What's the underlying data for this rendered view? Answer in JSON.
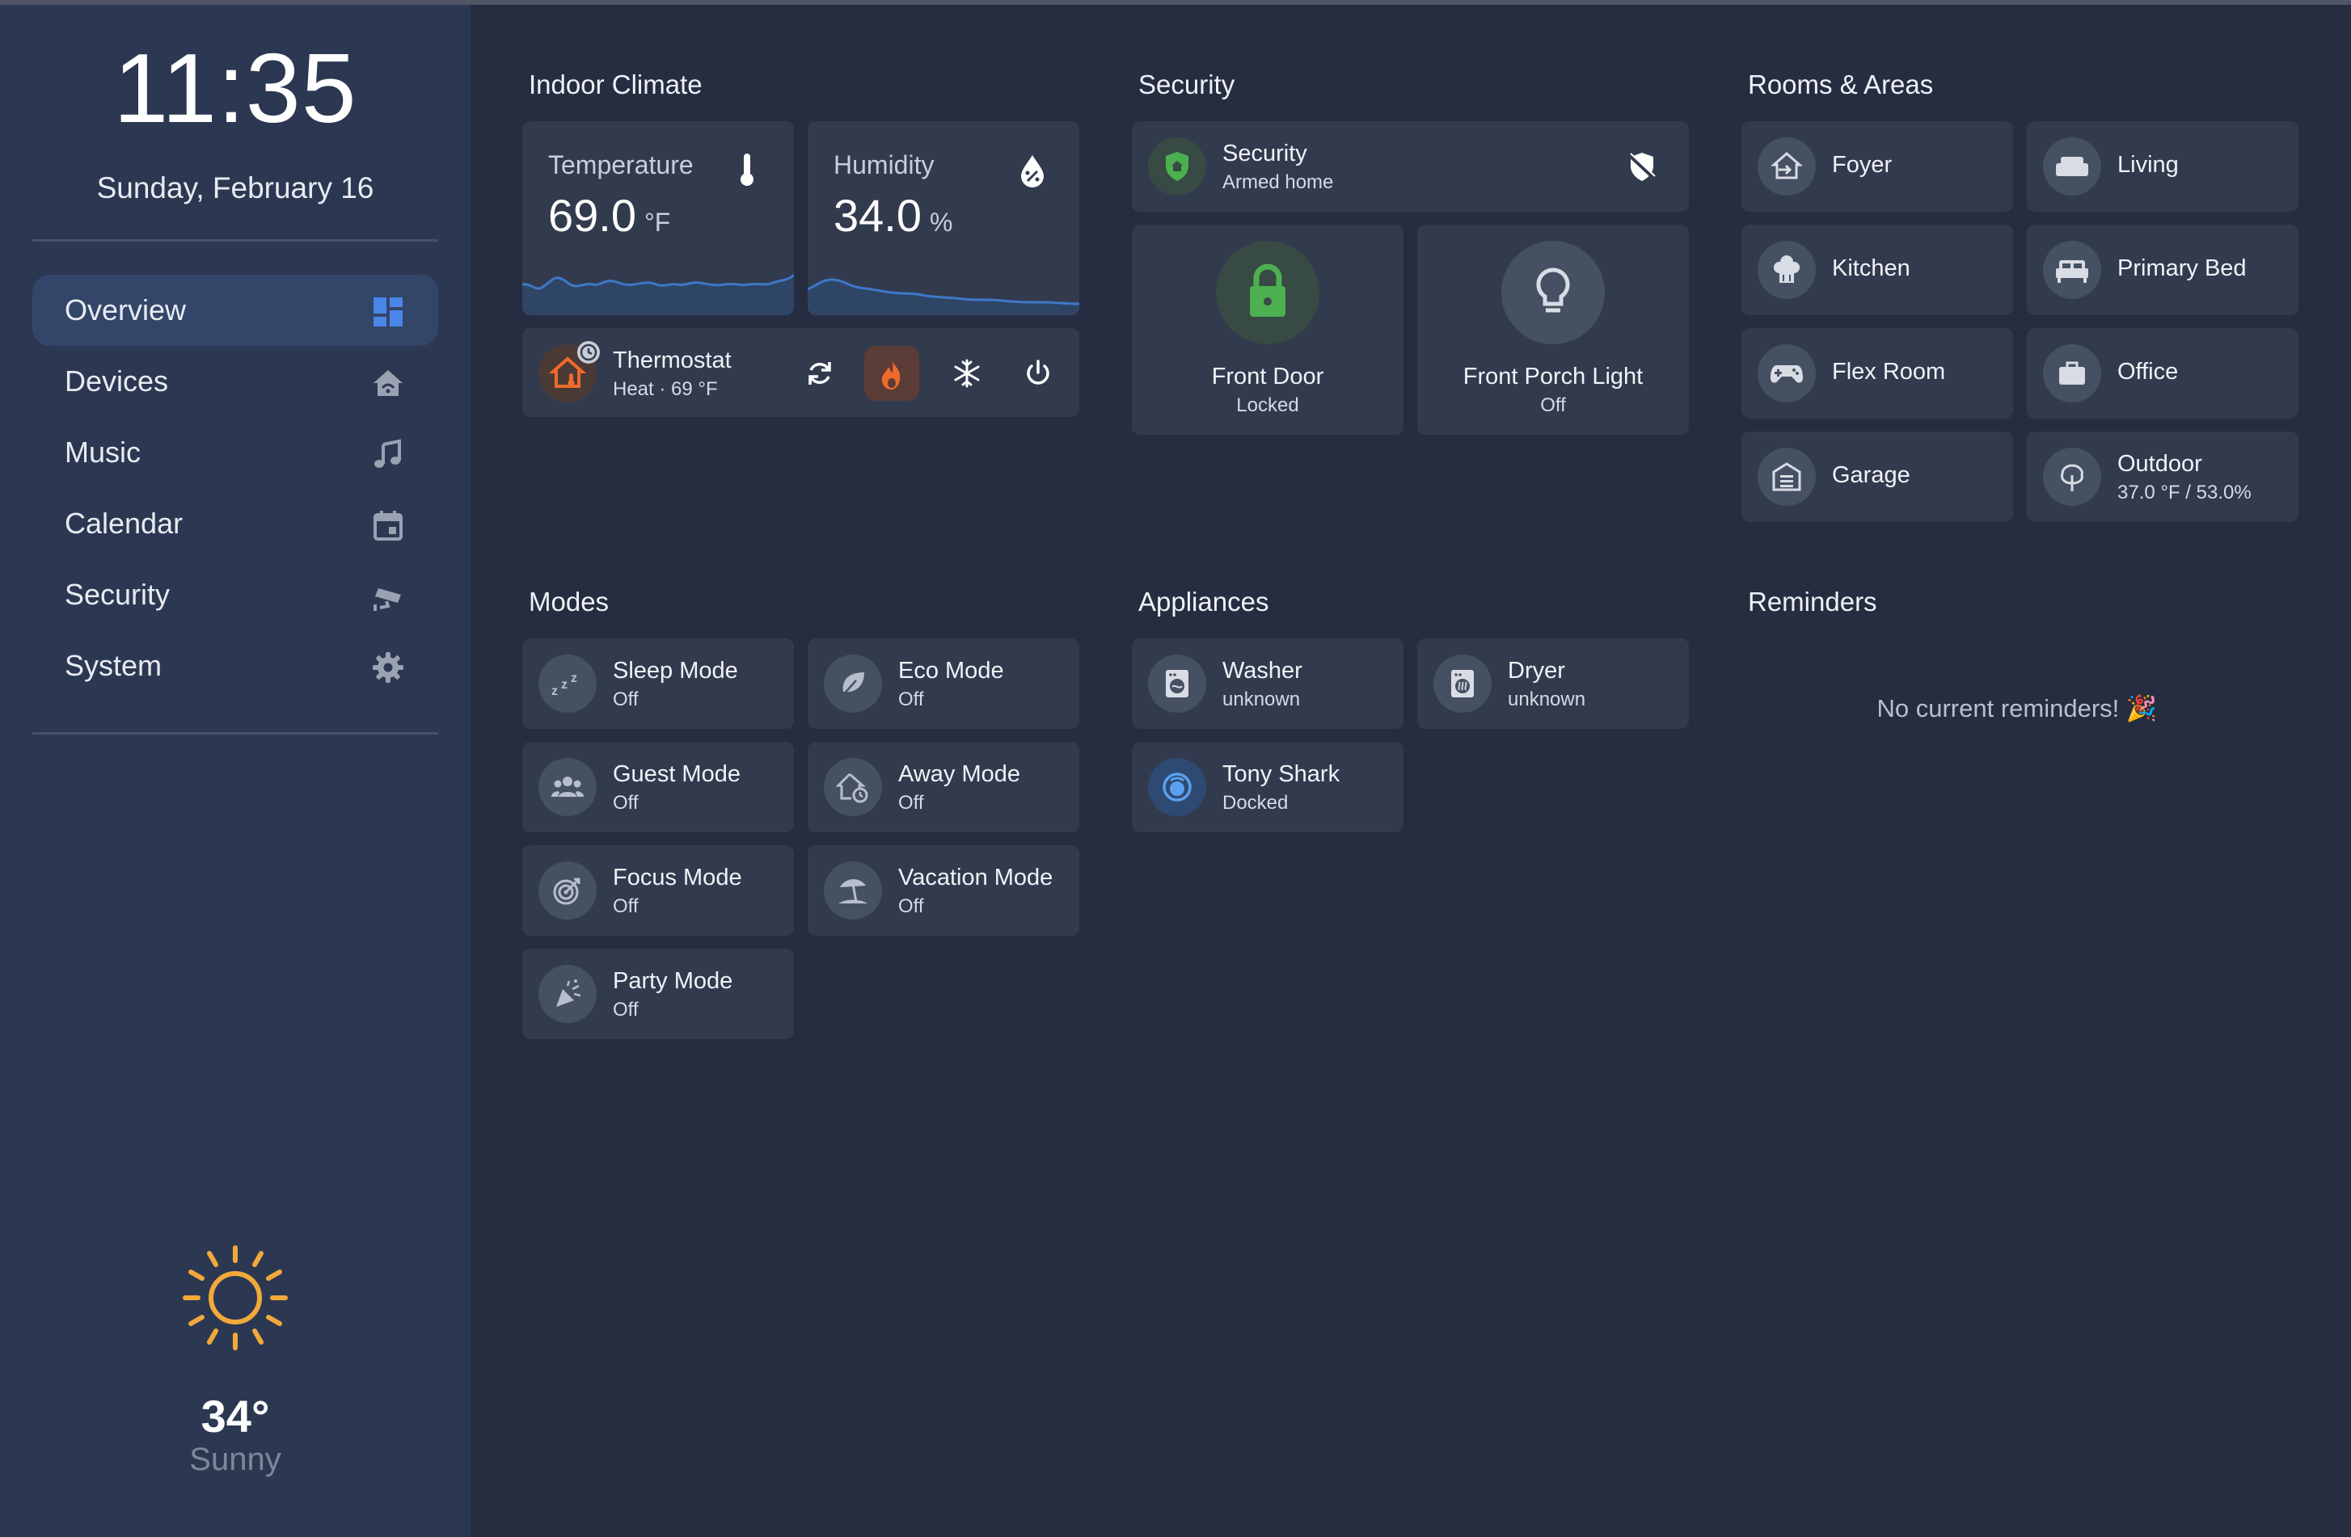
{
  "sidebar": {
    "clock": "11:35",
    "date": "Sunday, February 16",
    "nav": [
      {
        "label": "Overview",
        "icon": "dashboard-icon",
        "active": true
      },
      {
        "label": "Devices",
        "icon": "home-icon",
        "active": false
      },
      {
        "label": "Music",
        "icon": "music-note-icon",
        "active": false
      },
      {
        "label": "Calendar",
        "icon": "calendar-icon",
        "active": false
      },
      {
        "label": "Security",
        "icon": "cctv-camera-icon",
        "active": false
      },
      {
        "label": "System",
        "icon": "gear-icon",
        "active": false
      }
    ],
    "weather": {
      "temperature": "34°",
      "condition": "Sunny",
      "icon": "sun-icon"
    }
  },
  "indoor_climate": {
    "title": "Indoor Climate",
    "temperature": {
      "label": "Temperature",
      "value": "69.0",
      "unit": "°F"
    },
    "humidity": {
      "label": "Humidity",
      "value": "34.0",
      "unit": "%"
    },
    "thermostat": {
      "name": "Thermostat",
      "state": "Heat · 69 °F"
    }
  },
  "security": {
    "title": "Security",
    "alarm": {
      "name": "Security",
      "state": "Armed home"
    },
    "front_door": {
      "name": "Front Door",
      "state": "Locked"
    },
    "porch_light": {
      "name": "Front Porch Light",
      "state": "Off"
    }
  },
  "rooms": {
    "title": "Rooms & Areas",
    "items": [
      {
        "name": "Foyer",
        "detail": ""
      },
      {
        "name": "Living",
        "detail": ""
      },
      {
        "name": "Kitchen",
        "detail": ""
      },
      {
        "name": "Primary Bed",
        "detail": ""
      },
      {
        "name": "Flex Room",
        "detail": ""
      },
      {
        "name": "Office",
        "detail": ""
      },
      {
        "name": "Garage",
        "detail": ""
      },
      {
        "name": "Outdoor",
        "detail": "37.0 °F / 53.0%"
      }
    ]
  },
  "modes": {
    "title": "Modes",
    "items": [
      {
        "name": "Sleep Mode",
        "state": "Off"
      },
      {
        "name": "Eco Mode",
        "state": "Off"
      },
      {
        "name": "Guest Mode",
        "state": "Off"
      },
      {
        "name": "Away Mode",
        "state": "Off"
      },
      {
        "name": "Focus Mode",
        "state": "Off"
      },
      {
        "name": "Vacation Mode",
        "state": "Off"
      },
      {
        "name": "Party Mode",
        "state": "Off"
      }
    ]
  },
  "appliances": {
    "title": "Appliances",
    "items": [
      {
        "name": "Washer",
        "state": "unknown"
      },
      {
        "name": "Dryer",
        "state": "unknown"
      },
      {
        "name": "Tony Shark",
        "state": "Docked"
      }
    ]
  },
  "reminders": {
    "title": "Reminders",
    "empty_text": "No current reminders! 🎉"
  },
  "colors": {
    "background": "#262d40",
    "sidebar": "#2c3852",
    "card": "#323a4e",
    "accent_blue": "#4a86e8",
    "heat_orange": "#f06a2b",
    "lock_green": "#4caf50",
    "sun_yellow": "#f2a93b"
  }
}
